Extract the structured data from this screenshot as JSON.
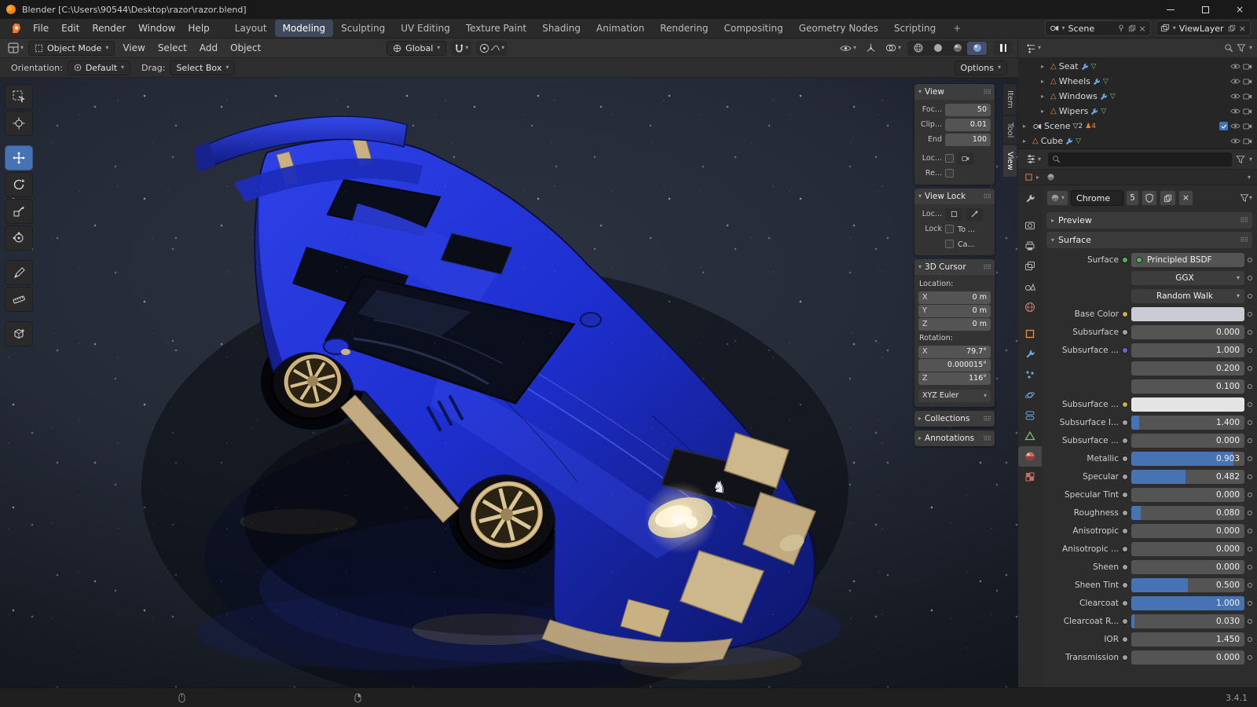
{
  "window": {
    "title": "Blender [C:\\Users\\90544\\Desktop\\razor\\razor.blend]"
  },
  "menubar": {
    "menus": [
      "File",
      "Edit",
      "Render",
      "Window",
      "Help"
    ],
    "workspaces": [
      {
        "label": "Layout"
      },
      {
        "label": "Modeling",
        "active": true
      },
      {
        "label": "Sculpting"
      },
      {
        "label": "UV Editing"
      },
      {
        "label": "Texture Paint"
      },
      {
        "label": "Shading"
      },
      {
        "label": "Animation"
      },
      {
        "label": "Rendering"
      },
      {
        "label": "Compositing"
      },
      {
        "label": "Geometry Nodes"
      },
      {
        "label": "Scripting"
      }
    ],
    "add_label": "+",
    "scene_value": "Scene",
    "viewlayer_value": "ViewLayer"
  },
  "tool_header": {
    "mode": "Object Mode",
    "menus": [
      "View",
      "Select",
      "Add",
      "Object"
    ],
    "orientation": "Global"
  },
  "options_bar": {
    "orientation_label": "Orientation:",
    "orientation_value": "Default",
    "drag_label": "Drag:",
    "drag_value": "Select Box",
    "options_label": "Options"
  },
  "npanel": {
    "tabs": [
      {
        "label": "Item"
      },
      {
        "label": "Tool"
      },
      {
        "label": "View",
        "active": true
      }
    ],
    "view_section": {
      "title": "View",
      "focal_label": "Foc...",
      "focal_value": "50",
      "clip_label": "Clip...",
      "clip_value": "0.01",
      "end_label": "End",
      "end_value": "100",
      "local_label": "Loc...",
      "render_label": "Re..."
    },
    "view_lock_section": {
      "title": "View Lock",
      "lock_to_label": "Loc...",
      "lock_label": "Lock",
      "to_label": "To ...",
      "camera_label": "Ca..."
    },
    "cursor_section": {
      "title": "3D Cursor",
      "location_label": "Location:",
      "location_rows": [
        {
          "axis": "X",
          "value": "0 m"
        },
        {
          "axis": "Y",
          "value": "0 m"
        },
        {
          "axis": "Z",
          "value": "0 m"
        }
      ],
      "rotation_label": "Rotation:",
      "rotation_rows": [
        {
          "axis": "X",
          "value": "79.7°"
        },
        {
          "axis": "",
          "value": "0.000015°"
        },
        {
          "axis": "Z",
          "value": "116°"
        }
      ],
      "rotation_mode": "XYZ Euler"
    },
    "collections_section": {
      "title": "Collections"
    },
    "annotations_section": {
      "title": "Annotations"
    }
  },
  "outliner": {
    "rows": [
      {
        "label": "Seat"
      },
      {
        "label": "Wheels"
      },
      {
        "label": "Windows"
      },
      {
        "label": "Wipers"
      }
    ],
    "scene_row": {
      "label": "Scene",
      "badge_a": "2",
      "badge_b": "4"
    },
    "cube_row": {
      "label": "Cube"
    }
  },
  "properties": {
    "material": {
      "name": "Chrome",
      "users": "5"
    },
    "preview_title": "Preview",
    "surface_title": "Surface",
    "rows": [
      {
        "label": "Surface",
        "kind": "shader",
        "value": "Principled BSDF",
        "socket": "#56b356"
      },
      {
        "label": "",
        "kind": "dropdown",
        "value": "GGX"
      },
      {
        "label": "",
        "kind": "dropdown",
        "value": "Random Walk"
      },
      {
        "label": "Base Color",
        "kind": "color",
        "socket": "#c9b043",
        "swatch": "#c9ccd4"
      },
      {
        "label": "Subsurface",
        "kind": "slider",
        "value": "0.000",
        "fill": 0,
        "socket": "#a1a1a1"
      },
      {
        "label": "Subsurface ...",
        "kind": "field",
        "value": "1.000",
        "socket": "#7561c9"
      },
      {
        "label": "",
        "kind": "field",
        "value": "0.200"
      },
      {
        "label": "",
        "kind": "field",
        "value": "0.100"
      },
      {
        "label": "Subsurface ...",
        "kind": "color",
        "socket": "#c9b043",
        "swatch": "#e4e4e4"
      },
      {
        "label": "Subsurface I...",
        "kind": "slider",
        "value": "1.400",
        "fill": 0.07,
        "socket": "#a1a1a1"
      },
      {
        "label": "Subsurface ...",
        "kind": "slider",
        "value": "0.000",
        "fill": 0,
        "socket": "#a1a1a1"
      },
      {
        "label": "Metallic",
        "kind": "slider",
        "value": "0.903",
        "fill": 0.903,
        "socket": "#a1a1a1"
      },
      {
        "label": "Specular",
        "kind": "slider",
        "value": "0.482",
        "fill": 0.482,
        "socket": "#a1a1a1"
      },
      {
        "label": "Specular Tint",
        "kind": "slider",
        "value": "0.000",
        "fill": 0,
        "socket": "#a1a1a1"
      },
      {
        "label": "Roughness",
        "kind": "slider",
        "value": "0.080",
        "fill": 0.08,
        "socket": "#a1a1a1"
      },
      {
        "label": "Anisotropic",
        "kind": "slider",
        "value": "0.000",
        "fill": 0,
        "socket": "#a1a1a1"
      },
      {
        "label": "Anisotropic ...",
        "kind": "slider",
        "value": "0.000",
        "fill": 0,
        "socket": "#a1a1a1"
      },
      {
        "label": "Sheen",
        "kind": "slider",
        "value": "0.000",
        "fill": 0,
        "socket": "#a1a1a1"
      },
      {
        "label": "Sheen Tint",
        "kind": "slider",
        "value": "0.500",
        "fill": 0.5,
        "socket": "#a1a1a1"
      },
      {
        "label": "Clearcoat",
        "kind": "slider",
        "value": "1.000",
        "fill": 1,
        "socket": "#a1a1a1"
      },
      {
        "label": "Clearcoat R...",
        "kind": "slider",
        "value": "0.030",
        "fill": 0.03,
        "socket": "#a1a1a1"
      },
      {
        "label": "IOR",
        "kind": "field",
        "value": "1.450",
        "socket": "#a1a1a1"
      },
      {
        "label": "Transmission",
        "kind": "slider",
        "value": "0.000",
        "fill": 0,
        "socket": "#a1a1a1"
      }
    ]
  },
  "statusbar": {
    "version": "3.4.1"
  },
  "theme": {
    "accent_blue": "#4772b3",
    "field_gray": "#545454",
    "car_body_blue": "#1e2fd0",
    "wheel_gold": "#d7c08c"
  }
}
